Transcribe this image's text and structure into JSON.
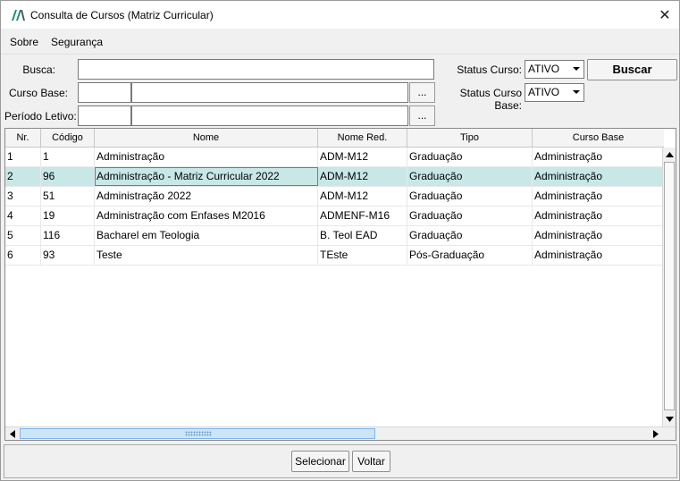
{
  "window": {
    "title": "Consulta de Cursos (Matriz Curricular)",
    "close_glyph": "✕"
  },
  "menu": [
    {
      "label": "Sobre"
    },
    {
      "label": "Segurança"
    }
  ],
  "filters": {
    "busca_label": "Busca:",
    "busca_value": "",
    "curso_base_label": "Curso Base:",
    "curso_base_code": "",
    "curso_base_name": "",
    "periodo_label": "Período Letivo:",
    "periodo_code": "",
    "periodo_name": "",
    "lookup_label": "...",
    "status_curso_label": "Status Curso:",
    "status_curso_value": "ATIVO",
    "status_curso_base_label": "Status Curso Base:",
    "status_curso_base_value": "ATIVO",
    "buscar_label": "Buscar"
  },
  "table": {
    "columns": [
      "Nr.",
      "Código",
      "Nome",
      "Nome Red.",
      "Tipo",
      "Curso Base"
    ],
    "rows": [
      [
        "1",
        "1",
        "Administração",
        "ADM-M12",
        "Graduação",
        "Administração"
      ],
      [
        "2",
        "96",
        "Administração - Matriz Curricular 2022",
        "ADM-M12",
        "Graduação",
        "Administração"
      ],
      [
        "3",
        "51",
        "Administração 2022",
        "ADM-M12",
        "Graduação",
        "Administração"
      ],
      [
        "4",
        "19",
        "Administração com Enfases M2016",
        "ADMENF-M16",
        "Graduação",
        "Administração"
      ],
      [
        "5",
        "116",
        "Bacharel em Teologia",
        "B. Teol EAD",
        "Graduação",
        "Administração"
      ],
      [
        "6",
        "93",
        "Teste",
        "TEste",
        "Pós-Graduação",
        "Administração"
      ]
    ],
    "selected_row": 2
  },
  "footer": {
    "selecionar_label": "Selecionar",
    "voltar_label": "Voltar"
  },
  "colors": {
    "selected_row": "#c8e8e8",
    "scroll_thumb": "#cde6f7",
    "logo": "#1a8a7a"
  }
}
